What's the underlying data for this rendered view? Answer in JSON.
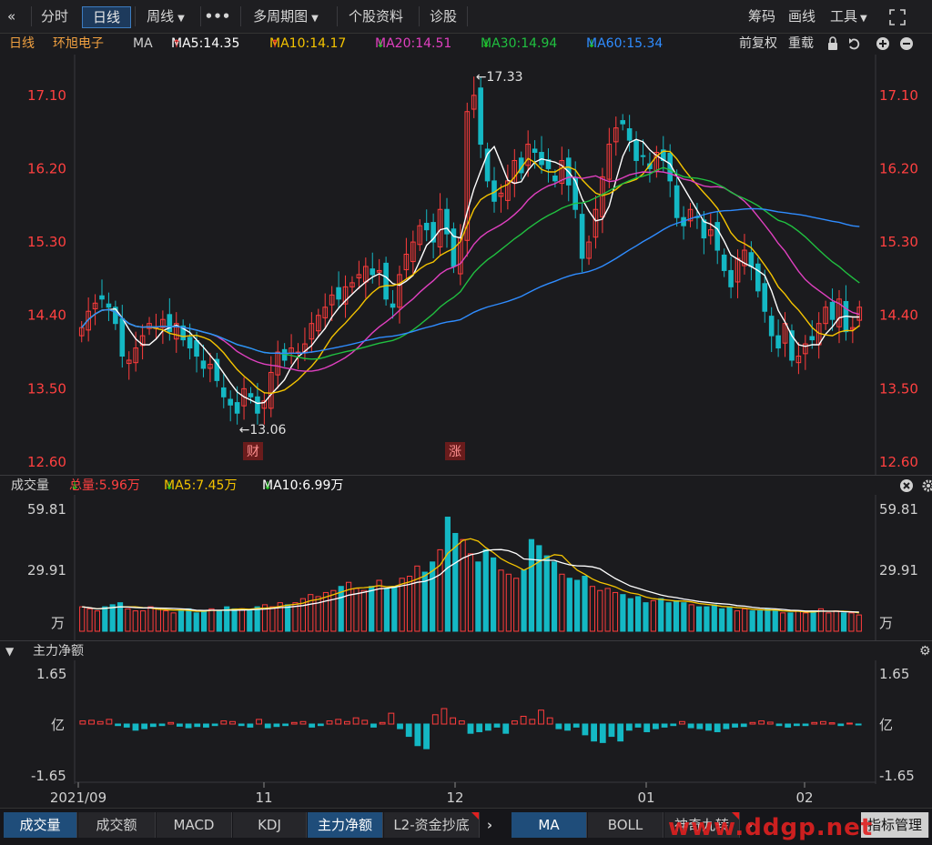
{
  "toolbar": {
    "back_icon": "double-chevron-left-icon",
    "items": [
      "分时",
      "日线",
      "周线",
      "多周期图",
      "个股资料",
      "诊股"
    ],
    "more": "•••",
    "right_items": [
      "筹码",
      "画线",
      "工具"
    ]
  },
  "legend": {
    "period": "日线",
    "stock_name": "环旭电子",
    "indicator": "MA",
    "ma5": "MA5:14.35",
    "ma10": "MA10:14.17",
    "ma20": "MA20:14.51",
    "ma30": "MA30:14.94",
    "ma60": "MA60:15.34",
    "adjust": "前复权",
    "overlay": "重载"
  },
  "price_panel": {
    "y_ticks": [
      "17.10",
      "16.20",
      "15.30",
      "14.40",
      "13.50",
      "12.60"
    ],
    "high_label": "←17.33",
    "low_label": "←13.06",
    "markers": [
      "财",
      "涨"
    ]
  },
  "volume_panel": {
    "title": "成交量",
    "total": "总量:5.96万",
    "ma5": "MA5:7.45万",
    "ma10": "MA10:6.99万",
    "y_ticks": [
      "59.81",
      "29.91",
      "万"
    ]
  },
  "flow_panel": {
    "title": "主力净额",
    "y_ticks": [
      "1.65",
      "亿",
      "-1.65"
    ]
  },
  "x_axis": [
    "2021/09",
    "11",
    "12",
    "01",
    "02"
  ],
  "bottom_tabs": [
    "成交量",
    "成交额",
    "MACD",
    "KDJ",
    "主力净额",
    "L2-资金抄底"
  ],
  "bottom_tabs2": [
    "MA",
    "BOLL",
    "神奇九转",
    "指标管理"
  ],
  "watermark": "www.ddgp.net",
  "colors": {
    "up": "#ff3c3c",
    "down": "#14b8c4",
    "ma5": "#ffffff",
    "ma10": "#f5c400",
    "ma20": "#e040c0",
    "ma30": "#20c040",
    "ma60": "#2f8cff",
    "accent": "#3d7cc0"
  },
  "chart_data": {
    "type": "candlestick",
    "y_range": [
      12.6,
      17.6
    ],
    "high": 17.33,
    "low": 13.06,
    "closes": [
      14.25,
      14.45,
      14.55,
      14.6,
      14.5,
      14.3,
      13.9,
      13.85,
      14.0,
      14.15,
      14.3,
      14.25,
      14.35,
      14.2,
      14.3,
      14.1,
      14.0,
      13.9,
      13.75,
      13.8,
      13.6,
      13.4,
      13.3,
      13.2,
      13.5,
      13.4,
      13.2,
      13.35,
      13.7,
      13.95,
      13.85,
      14.0,
      13.95,
      14.05,
      14.3,
      14.4,
      14.5,
      14.65,
      14.6,
      14.75,
      14.8,
      14.9,
      15.0,
      14.9,
      14.95,
      14.6,
      14.5,
      14.9,
      15.15,
      15.3,
      15.5,
      15.45,
      15.3,
      15.7,
      15.4,
      15.0,
      15.35,
      16.9,
      17.1,
      16.5,
      16.05,
      15.8,
      15.9,
      16.05,
      16.3,
      16.15,
      16.5,
      16.4,
      16.25,
      16.2,
      16.05,
      16.3,
      16.0,
      15.7,
      15.1,
      15.3,
      15.7,
      16.1,
      16.5,
      16.7,
      16.75,
      16.55,
      16.3,
      16.35,
      16.2,
      16.4,
      16.3,
      16.05,
      15.6,
      15.5,
      15.7,
      15.6,
      15.35,
      15.45,
      15.2,
      14.95,
      14.75,
      15.1,
      15.2,
      15.0,
      14.7,
      14.45,
      14.15,
      14.0,
      14.3,
      13.85,
      13.9,
      14.05,
      14.1,
      14.3,
      14.5,
      14.35,
      14.6,
      14.2,
      14.25,
      14.5
    ],
    "volume": [
      12,
      11,
      10,
      12,
      13,
      14,
      11,
      10,
      10,
      12,
      11,
      10,
      9,
      10,
      11,
      9,
      10,
      11,
      10,
      12,
      11,
      11,
      10,
      12,
      13,
      12,
      14,
      13,
      14,
      16,
      18,
      17,
      19,
      20,
      22,
      24,
      21,
      20,
      22,
      25,
      21,
      22,
      26,
      27,
      32,
      29,
      34,
      40,
      56,
      48,
      45,
      38,
      34,
      40,
      36,
      30,
      28,
      26,
      30,
      45,
      42,
      37,
      34,
      28,
      26,
      25,
      27,
      22,
      20,
      21,
      19,
      18,
      16,
      17,
      14,
      15,
      16,
      14,
      15,
      14,
      13,
      12,
      12,
      13,
      11,
      12,
      10,
      11,
      10,
      10,
      11,
      10,
      9,
      9,
      10,
      9,
      10,
      11,
      9,
      10,
      9,
      9,
      8
    ],
    "net_flow": [
      0.1,
      0.12,
      0.08,
      0.15,
      -0.05,
      -0.1,
      -0.2,
      -0.15,
      -0.08,
      -0.05,
      0.05,
      -0.07,
      -0.12,
      -0.08,
      -0.1,
      -0.05,
      0.1,
      0.08,
      -0.05,
      -0.1,
      0.15,
      -0.12,
      -0.08,
      -0.05,
      0.05,
      0.08,
      -0.1,
      -0.05,
      0.1,
      0.15,
      0.08,
      0.2,
      0.12,
      -0.1,
      0.05,
      0.35,
      -0.15,
      -0.4,
      -0.7,
      -0.8,
      0.3,
      0.5,
      0.2,
      0.1,
      -0.3,
      -0.25,
      -0.2,
      -0.1,
      -0.3,
      0.1,
      0.25,
      0.15,
      0.45,
      0.2,
      -0.15,
      -0.2,
      -0.1,
      -0.35,
      -0.55,
      -0.6,
      -0.4,
      -0.55,
      -0.2,
      -0.1,
      -0.25,
      -0.15,
      -0.1,
      -0.05,
      0.08,
      -0.12,
      -0.15,
      -0.2,
      -0.25,
      -0.15,
      -0.1,
      -0.08,
      0.05,
      0.1,
      0.06,
      -0.05,
      -0.1,
      -0.05,
      -0.05,
      0.05,
      0.08,
      0.04,
      -0.05,
      0.03,
      -0.03
    ]
  }
}
